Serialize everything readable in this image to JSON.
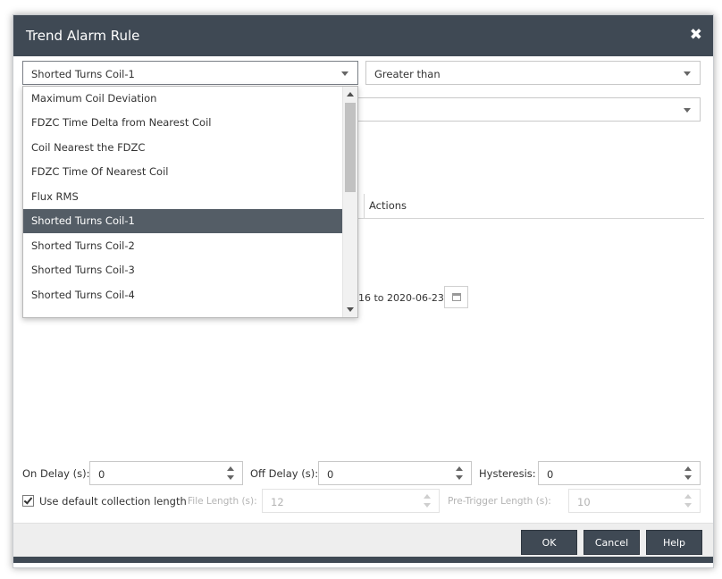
{
  "dialog": {
    "title": "Trend Alarm Rule",
    "close_glyph": "✖"
  },
  "parameter_select": {
    "value": "Shorted Turns Coil-1"
  },
  "condition_select": {
    "value": "Greater than"
  },
  "second_select": {
    "value": ""
  },
  "tabs": {
    "actions_label": "Actions"
  },
  "date_range": {
    "text": "-16 to 2020-06-23"
  },
  "dropdown": {
    "items": [
      "Maximum Coil Deviation",
      "FDZC Time Delta from Nearest Coil",
      "Coil Nearest the FDZC",
      "FDZC Time Of Nearest Coil",
      "Flux RMS",
      "Shorted Turns Coil-1",
      "Shorted Turns Coil-2",
      "Shorted Turns Coil-3",
      "Shorted Turns Coil-4"
    ],
    "selected": "Shorted Turns Coil-1"
  },
  "delays": {
    "on_delay_label": "On Delay (s):",
    "on_delay_value": "0",
    "off_delay_label": "Off Delay (s):",
    "off_delay_value": "0",
    "hysteresis_label": "Hysteresis:",
    "hysteresis_value": "0"
  },
  "collection": {
    "use_default_label": "Use default collection length",
    "use_default_checked": true,
    "file_length_label": "File Length (s):",
    "file_length_value": "12",
    "pre_trigger_label": "Pre-Trigger Length (s):",
    "pre_trigger_value": "10"
  },
  "footer": {
    "ok_label": "OK",
    "cancel_label": "Cancel",
    "help_label": "Help"
  },
  "colors": {
    "header": "#3f4954",
    "selected_item": "#545d66",
    "footer_bg": "#eeeeee"
  }
}
